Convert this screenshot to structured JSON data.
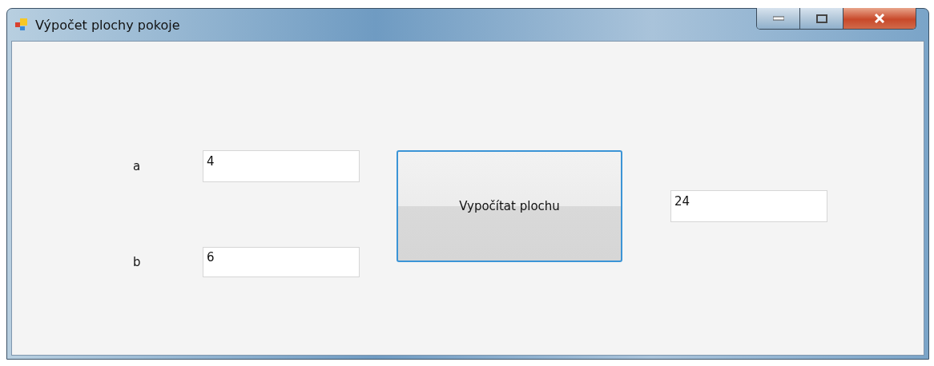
{
  "window": {
    "title": "Výpočet plochy pokoje"
  },
  "fields": [
    {
      "label": "a",
      "value": "4"
    },
    {
      "label": "b",
      "value": "6"
    }
  ],
  "button": {
    "label": "Vypočítat plochu"
  },
  "result": {
    "value": "24"
  }
}
